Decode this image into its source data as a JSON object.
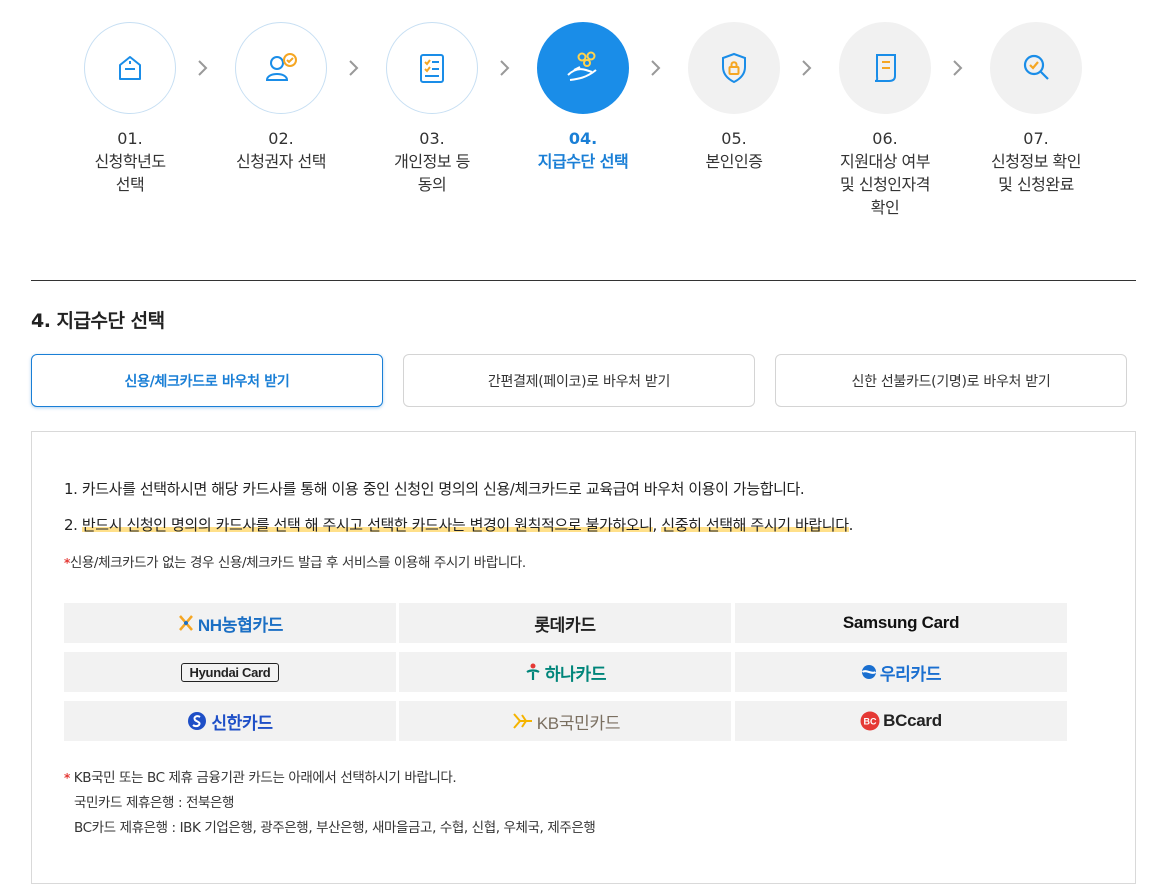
{
  "steps": [
    {
      "num": "01.",
      "label": "신청학년도\n선택",
      "state": "done",
      "icon": "building-icon"
    },
    {
      "num": "02.",
      "label": "신청권자 선택",
      "state": "done",
      "icon": "user-check-icon"
    },
    {
      "num": "03.",
      "label": "개인정보 등\n동의",
      "state": "done",
      "icon": "checklist-icon"
    },
    {
      "num": "04.",
      "label": "지급수단 선택",
      "state": "active",
      "icon": "hand-coins-icon"
    },
    {
      "num": "05.",
      "label": "본인인증",
      "state": "todo",
      "icon": "shield-lock-icon"
    },
    {
      "num": "06.",
      "label": "지원대상 여부\n및 신청인자격\n확인",
      "state": "todo",
      "icon": "document-icon"
    },
    {
      "num": "07.",
      "label": "신청정보 확인\n및 신청완료",
      "state": "todo",
      "icon": "search-check-icon"
    }
  ],
  "section_title": "4. 지급수단 선택",
  "tabs": [
    {
      "label": "신용/체크카드로 바우처 받기",
      "active": true
    },
    {
      "label": "간편결제(페이코)로 바우처 받기",
      "active": false
    },
    {
      "label": "신한 선불카드(기명)로 바우처 받기",
      "active": false
    }
  ],
  "notices": {
    "line1": "1. 카드사를 선택하시면 해당 카드사를 통해 이용 중인 신청인 명의의 신용/체크카드로 교육급여 바우처 이용이 가능합니다.",
    "line2_prefix": "2. ",
    "line2_highlight1": "반드시 신청인 명의의 카드사를 선택 해 주시고 선택한 카드사는 변경이 원칙적으로 불가하오니",
    "line2_sep": ", ",
    "line2_highlight2": "신중히 선택해 주시기 바랍니다",
    "line2_end": ".",
    "asterisk": "*",
    "note": "신용/체크카드가 없는 경우 신용/체크카드 발급 후 서비스를 이용해 주시기 바랍니다."
  },
  "cards": [
    {
      "name": "NH농협카드",
      "color": "#1b6fc4"
    },
    {
      "name": "롯데카드",
      "color": "#222222"
    },
    {
      "name": "Samsung Card",
      "color": "#111111"
    },
    {
      "name": "Hyundai Card",
      "color": "#222222"
    },
    {
      "name": "하나카드",
      "color": "#00857a"
    },
    {
      "name": "우리카드",
      "color": "#1a6fd0"
    },
    {
      "name": "신한카드",
      "color": "#1e4fc7"
    },
    {
      "name": "KB국민카드",
      "color": "#7a6f60"
    },
    {
      "name": "BCcard",
      "color": "#222222"
    }
  ],
  "footer": {
    "asterisk": "*",
    "line1": " KB국민 또는 BC 제휴 금융기관 카드는 아래에서 선택하시기 바랍니다.",
    "line2": "국민카드 제휴은행 : 전북은행",
    "line3": "BC카드 제휴은행 : IBK 기업은행, 광주은행, 부산은행, 새마을금고, 수협, 신협, 우체국, 제주은행"
  },
  "colors": {
    "accent": "#1a8de8",
    "highlight": "#ffe08a",
    "asterisk": "#e53935"
  }
}
